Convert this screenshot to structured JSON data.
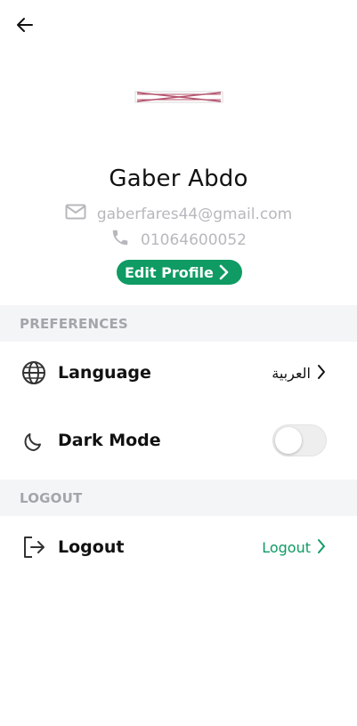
{
  "profile": {
    "name": "Gaber Abdo",
    "email": "gaberfares44@gmail.com",
    "phone": "01064600052",
    "edit_label": "Edit Profile"
  },
  "sections": {
    "preferences_title": "PREFERENCES",
    "logout_title": "LOGOUT"
  },
  "rows": {
    "language": {
      "label": "Language",
      "value": "العربية"
    },
    "dark_mode": {
      "label": "Dark Mode",
      "enabled": false
    },
    "logout": {
      "label": "Logout",
      "action": "Logout"
    }
  },
  "icons": {
    "back": "arrow-left-icon",
    "email": "mail-icon",
    "phone": "phone-icon",
    "language": "globe-icon",
    "dark_mode": "moon-icon",
    "logout": "logout-icon",
    "chevron": "chevron-right-icon"
  },
  "colors": {
    "accent": "#0f9b63",
    "muted": "#b7b8bd",
    "section_bg": "#f4f5f7"
  }
}
